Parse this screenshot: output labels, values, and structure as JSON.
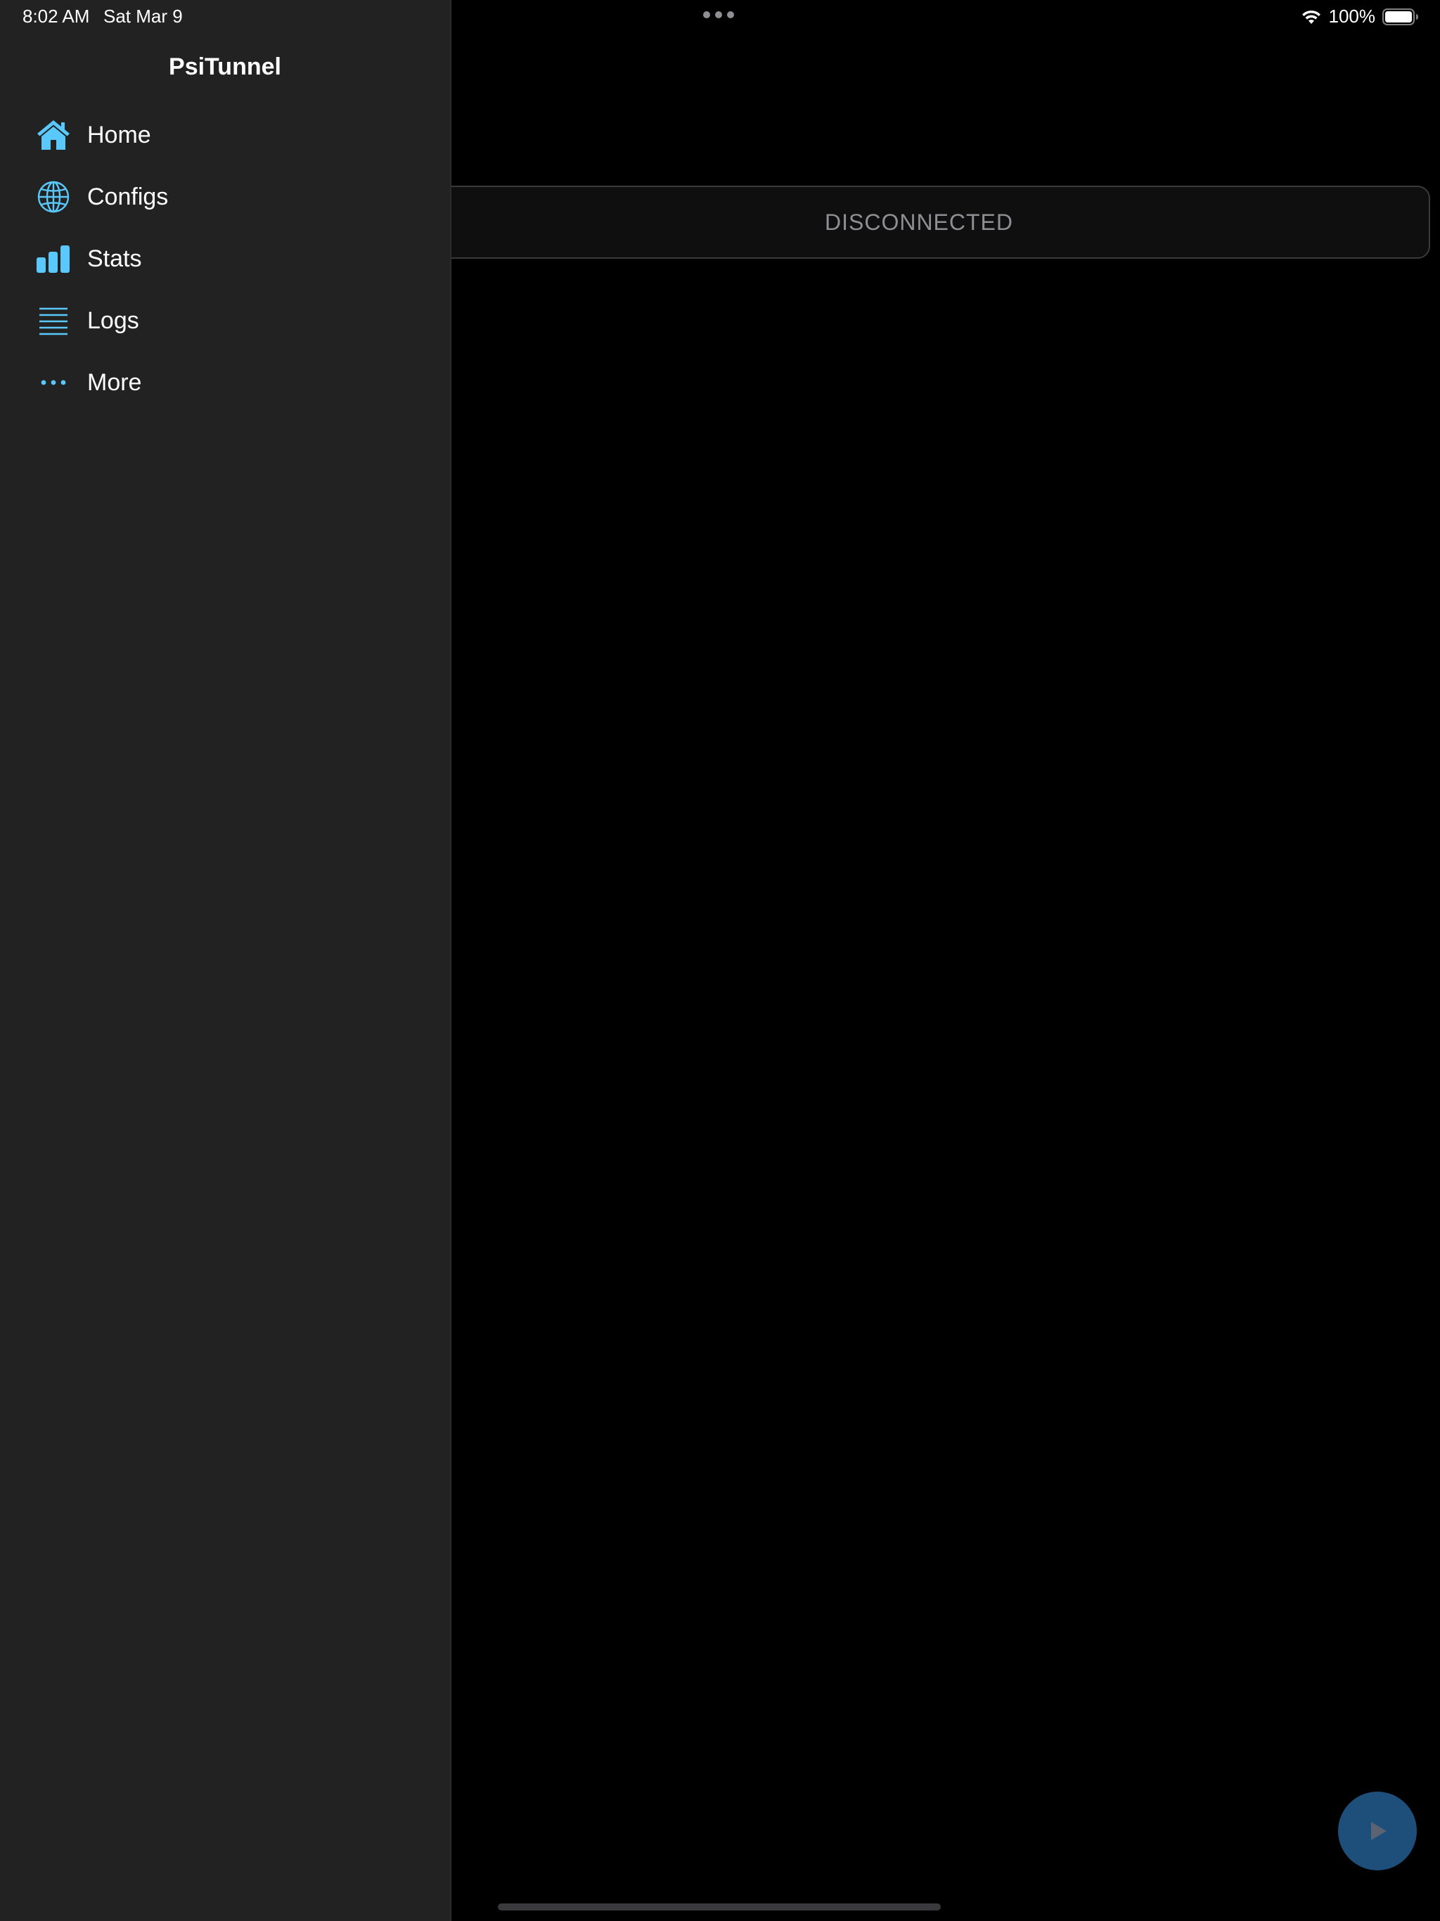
{
  "status_bar": {
    "time": "8:02 AM",
    "date": "Sat Mar 9",
    "battery": "100%",
    "icons": [
      "wifi-icon",
      "battery-icon"
    ]
  },
  "sidebar": {
    "title": "PsiTunnel",
    "items": [
      {
        "label": "Home",
        "icon": "house-icon"
      },
      {
        "label": "Configs",
        "icon": "globe-icon"
      },
      {
        "label": "Stats",
        "icon": "bar-chart-icon"
      },
      {
        "label": "Logs",
        "icon": "list-lines-icon"
      },
      {
        "label": "More",
        "icon": "ellipsis-icon"
      }
    ]
  },
  "main": {
    "connection_status": "DISCONNECTED",
    "play_button_icon": "play-icon"
  },
  "colors": {
    "accent": "#5ac8fa",
    "sidebar_background": "#222222",
    "main_background": "#000000",
    "status_text": "#8e8e93",
    "play_button": "#1e4e7a"
  }
}
